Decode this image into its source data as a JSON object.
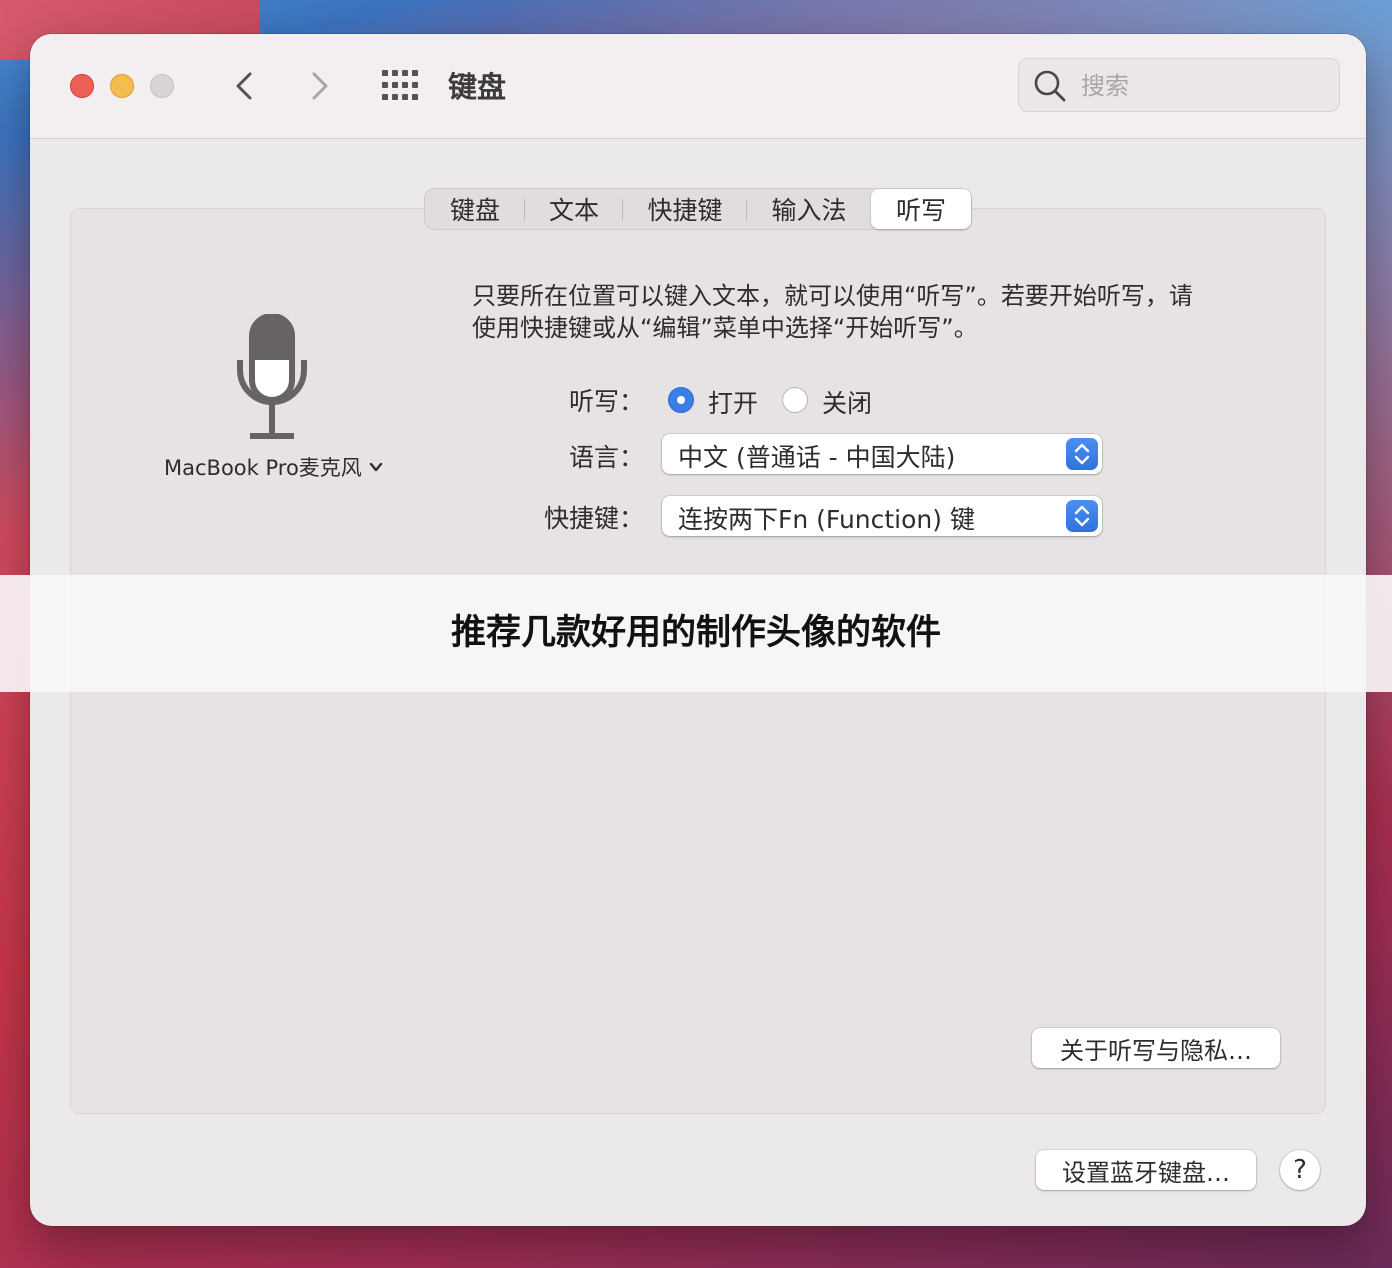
{
  "window": {
    "title": "键盘",
    "search_placeholder": "搜索"
  },
  "tabs": [
    {
      "label": "键盘",
      "active": false
    },
    {
      "label": "文本",
      "active": false
    },
    {
      "label": "快捷键",
      "active": false
    },
    {
      "label": "输入法",
      "active": false
    },
    {
      "label": "听写",
      "active": true
    }
  ],
  "dictation": {
    "mic_source": "MacBook Pro麦克风",
    "description": "只要所在位置可以键入文本，就可以使用“听写”。若要开始听写，请使用快捷键或从“编辑”菜单中选择“开始听写”。",
    "toggle_label": "听写：",
    "on_label": "打开",
    "off_label": "关闭",
    "selected": "on",
    "language_label": "语言：",
    "language_value": "中文 (普通话 - 中国大陆)",
    "shortcut_label": "快捷键：",
    "shortcut_value": "连按两下Fn (Function) 键",
    "privacy_button": "关于听写与隐私…"
  },
  "footer": {
    "bluetooth_button": "设置蓝牙键盘…",
    "help_button": "?"
  },
  "overlay_banner": "推荐几款好用的制作头像的软件",
  "colors": {
    "accent": "#3b7ee6",
    "close": "#ec5f57",
    "minimize": "#f5bd4f",
    "zoom_disabled": "#d8d5d6"
  }
}
